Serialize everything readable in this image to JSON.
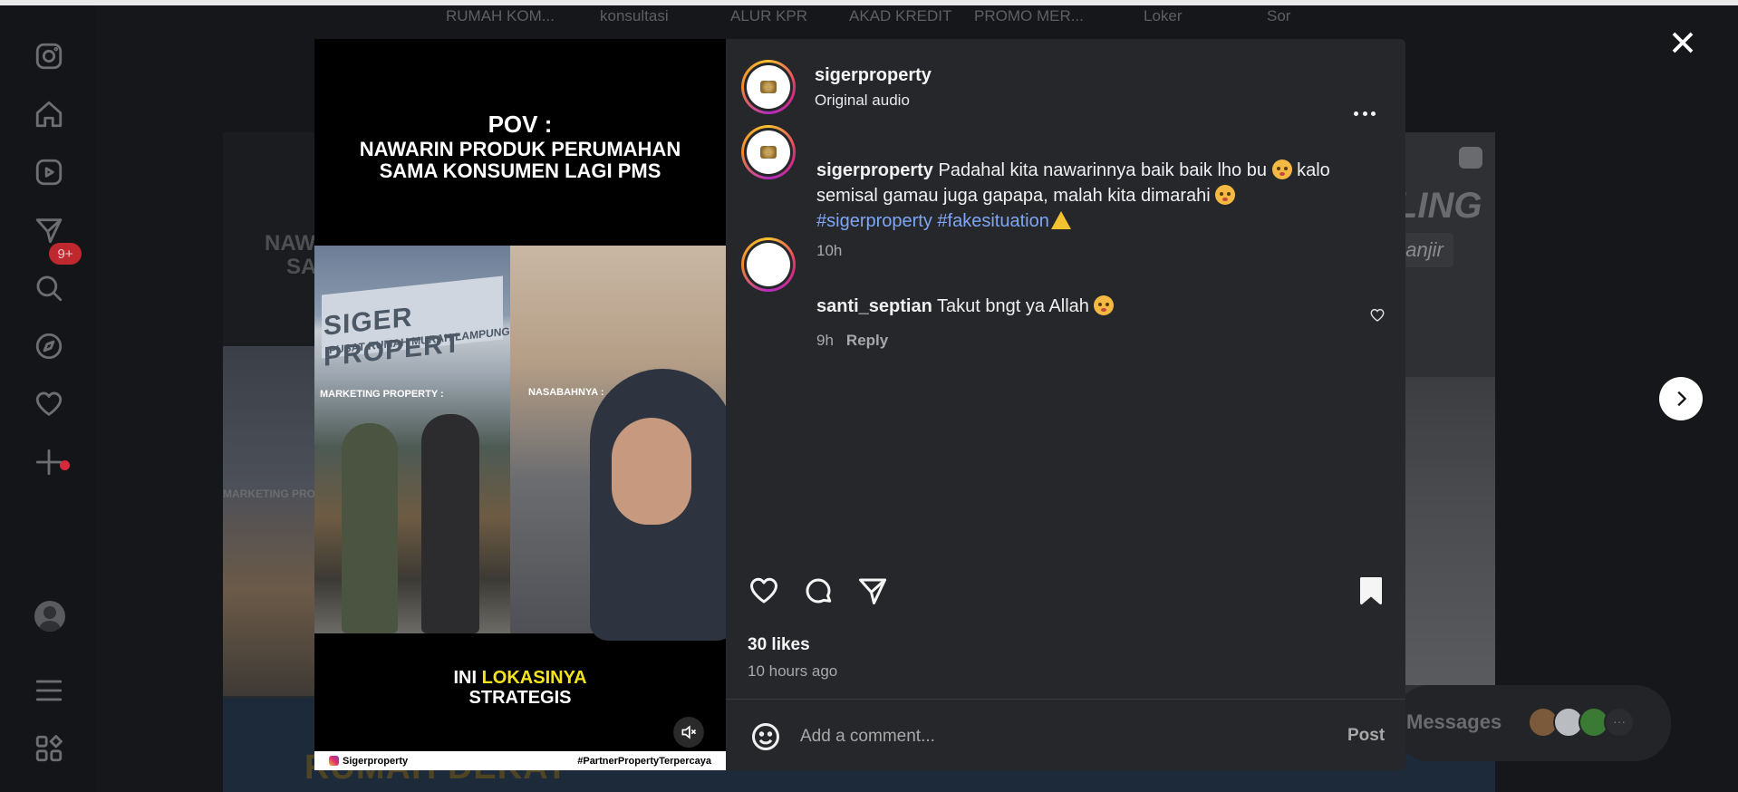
{
  "background": {
    "tabs": [
      "RUMAH KOM...",
      "konsultasi",
      "ALUR KPR",
      "AKAD KREDIT",
      "PROMO MER...",
      "Loker",
      "Sor"
    ],
    "left_card_text": [
      "NAW",
      "SA"
    ],
    "left_card_caption": "MARKETING PRO",
    "right_card_title": "LING",
    "right_card_chip": "anjir",
    "bottom_strip_text": "RUMAH DEKAT"
  },
  "nav": {
    "notification_badge": "9+",
    "icons": [
      "instagram-icon",
      "home-icon",
      "reels-icon",
      "messages-icon",
      "search-icon",
      "explore-icon",
      "notifications-icon",
      "create-icon",
      "profile-icon",
      "menu-icon",
      "more-apps-icon"
    ]
  },
  "messages": {
    "label": "Messages"
  },
  "media": {
    "pov_line1": "POV :",
    "pov_line2": "NAWARIN PRODUK PERUMAHAN",
    "pov_line3": "SAMA KONSUMEN LAGI PMS",
    "sign_text": "SIGER PROPERT",
    "sign_sub": "PUSAT RUMAH MURAH LAMPUNG",
    "label_left": "MARKETING PROPERTY :",
    "label_right": "NASABAHNYA :",
    "lokasi_prefix": "INI ",
    "lokasi_highlight": "LOKASINYA",
    "lokasi_line2": "STRATEGIS",
    "footer_handle": "Sigerproperty",
    "footer_tag": "#PartnerPropertyTerpercaya"
  },
  "post": {
    "username": "sigerproperty",
    "audio": "Original audio",
    "caption_user": "sigerproperty",
    "caption_text_1": " Padahal kita nawarinnya baik baik lho bu ",
    "caption_text_2": " kalo semisal gamau juga gapapa, malah kita dimarahi ",
    "hashtag_1": "#sigerproperty",
    "hashtag_2": "#fakesituation",
    "caption_time": "10h",
    "comment_user": "santi_septian",
    "comment_text": " Takut bngt ya Allah ",
    "comment_time": "9h",
    "comment_reply": "Reply",
    "likes": "30 likes",
    "time_ago": "10 hours ago",
    "comment_placeholder": "Add a comment...",
    "post_label": "Post"
  }
}
